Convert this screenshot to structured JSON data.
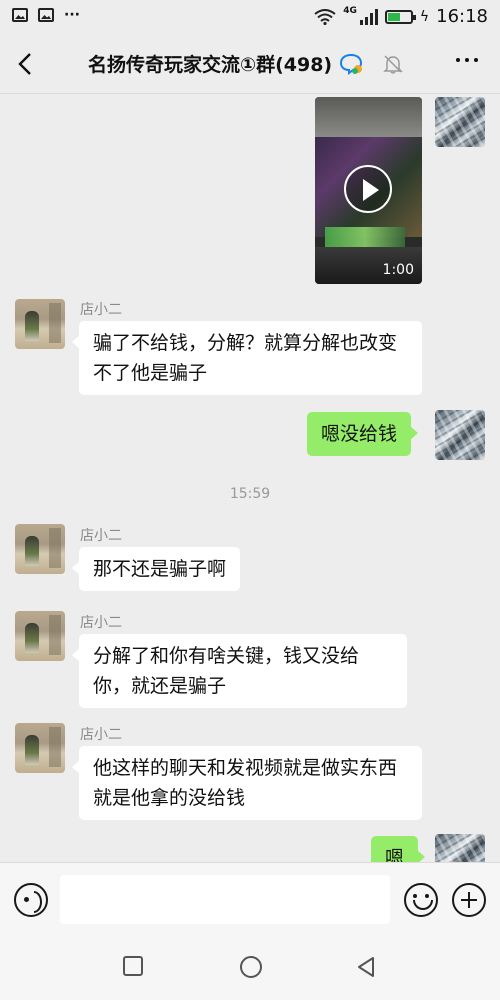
{
  "status_bar": {
    "network": "4G",
    "time": "16:18",
    "battery_level": 0.55
  },
  "header": {
    "title": "名扬传奇玩家交流①群(498)"
  },
  "messages": [
    {
      "type": "video",
      "direction": "out",
      "duration": "1:00"
    },
    {
      "type": "text",
      "direction": "in",
      "sender": "店小二",
      "text": "骗了不给钱，分解？就算分解也改变不了他是骗子"
    },
    {
      "type": "text",
      "direction": "out",
      "text": "嗯没给钱"
    },
    {
      "type": "timestamp",
      "text": "15:59"
    },
    {
      "type": "text",
      "direction": "in",
      "sender": "店小二",
      "text": "那不还是骗子啊"
    },
    {
      "type": "text",
      "direction": "in",
      "sender": "店小二",
      "text": "分解了和你有啥关键，钱又没给你，就还是骗子"
    },
    {
      "type": "text",
      "direction": "in",
      "sender": "店小二",
      "text": "他这样的聊天和发视频就是做实东西就是他拿的没给钱"
    },
    {
      "type": "text",
      "direction": "out",
      "text": "嗯"
    }
  ],
  "colors": {
    "outgoing_bubble": "#95ec69",
    "incoming_bubble": "#ffffff",
    "background": "#ededed"
  },
  "icons": {
    "back": "chevron-left-icon",
    "group_chat": "chat-bubble-icon",
    "mute": "bell-off-icon",
    "more": "more-dots-icon",
    "voice": "voice-icon",
    "emoji": "emoji-icon",
    "plus": "plus-icon"
  }
}
